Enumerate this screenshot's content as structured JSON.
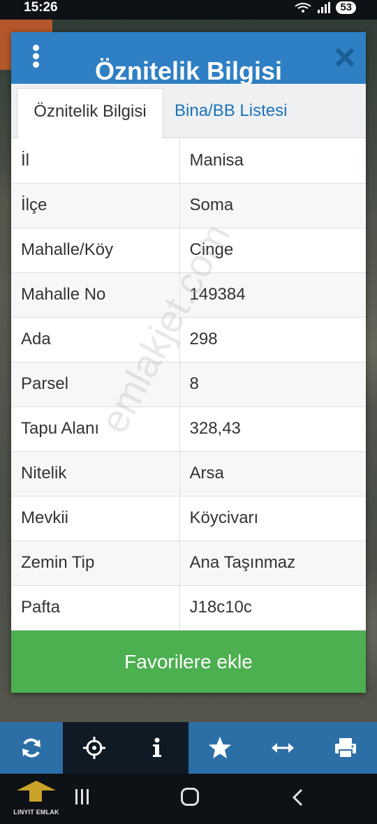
{
  "status_bar": {
    "time": "15:26",
    "battery": "53"
  },
  "dialog": {
    "title": "Öznitelik Bilgisi",
    "tabs": [
      {
        "label": "Öznitelik Bilgisi",
        "active": true
      },
      {
        "label": "Bina/BB Listesi",
        "active": false
      }
    ],
    "attributes": [
      {
        "key": "İl",
        "value": "Manisa"
      },
      {
        "key": "İlçe",
        "value": "Soma"
      },
      {
        "key": "Mahalle/Köy",
        "value": "Cinge"
      },
      {
        "key": "Mahalle No",
        "value": "149384"
      },
      {
        "key": "Ada",
        "value": "298"
      },
      {
        "key": "Parsel",
        "value": "8"
      },
      {
        "key": "Tapu Alanı",
        "value": "328,43"
      },
      {
        "key": "Nitelik",
        "value": "Arsa"
      },
      {
        "key": "Mevkii",
        "value": "Köycivarı"
      },
      {
        "key": "Zemin Tip",
        "value": "Ana Taşınmaz"
      },
      {
        "key": "Pafta",
        "value": "J18c10c"
      }
    ],
    "favorite_button": "Favorilere ekle"
  },
  "watermark": "emlakjet.com",
  "toolbar": {
    "items": [
      {
        "icon": "refresh-icon"
      },
      {
        "icon": "locate-icon"
      },
      {
        "icon": "info-icon"
      },
      {
        "icon": "star-icon"
      },
      {
        "icon": "measure-icon"
      },
      {
        "icon": "print-icon"
      }
    ]
  },
  "navbar": {
    "logo_text": "LINYIT EMLAK"
  },
  "colors": {
    "header_blue": "#2e7fc3",
    "tab_link_blue": "#1e73b8",
    "button_green": "#4caf50",
    "toolbar_blue": "#2c6ea6",
    "toolbar_dark": "#0f1a24",
    "logo_gold": "#c9a227"
  }
}
